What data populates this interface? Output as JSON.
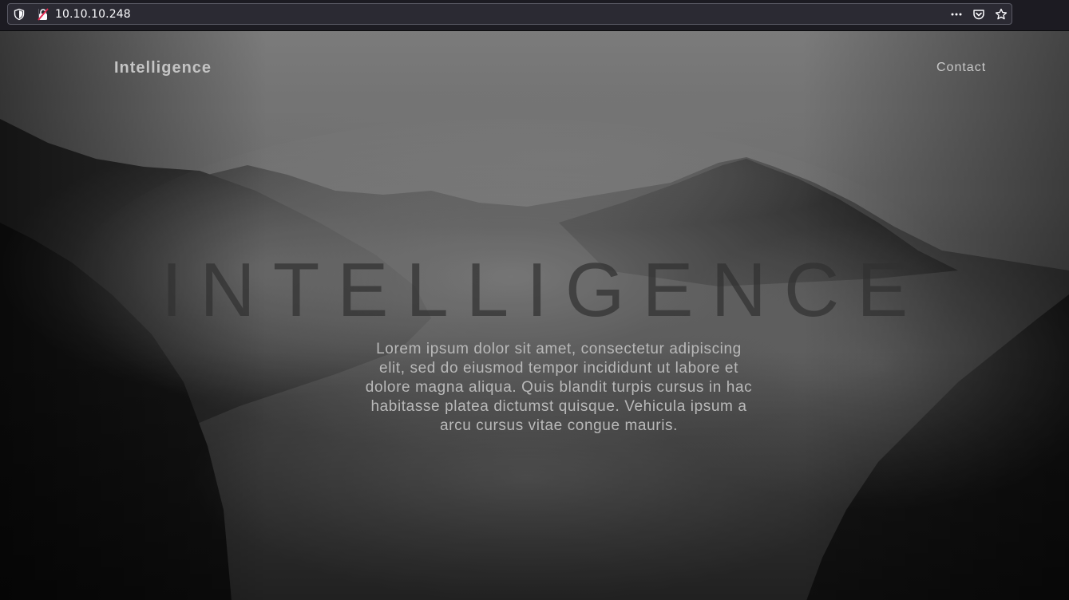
{
  "browser": {
    "url": "10.10.10.248",
    "icons": [
      "shield-icon",
      "insecure-lock-icon",
      "more-icon",
      "pocket-icon",
      "bookmark-star-icon"
    ]
  },
  "nav": {
    "brand": "Intelligence",
    "contact": "Contact"
  },
  "hero": {
    "title": "INTELLIGENCE",
    "text": "Lorem ipsum dolor sit amet, consectetur adipiscing elit, sed do eiusmod tempor incididunt ut labore et dolore magna aliqua. Quis blandit turpis cursus in hac habitasse platea dictumst quisque. Vehicula ipsum a arcu cursus vitae congue mauris."
  },
  "colors": {
    "chrome_bg": "#1c1b22",
    "urlbar_bg": "#2b2a33",
    "insecure_accent": "#e22850"
  }
}
